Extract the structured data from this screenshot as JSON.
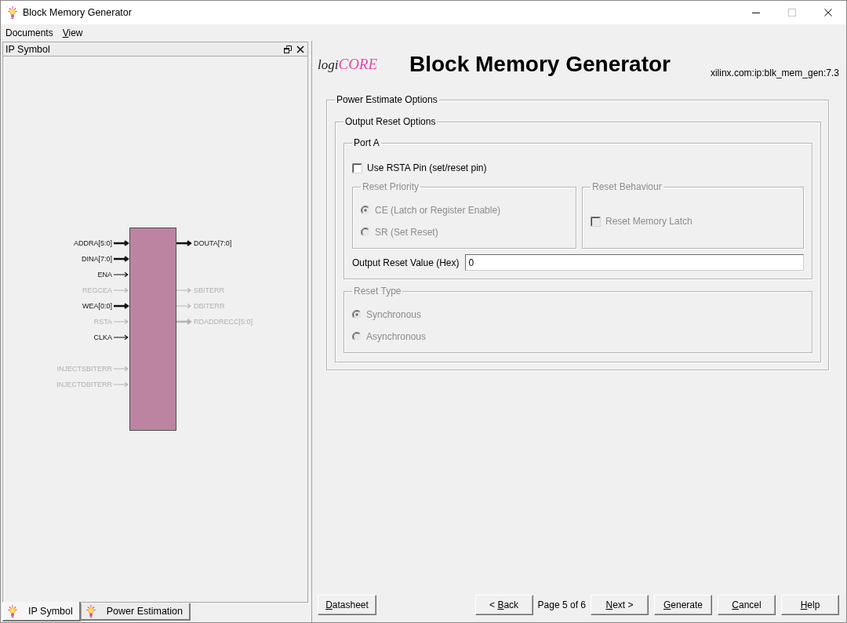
{
  "window": {
    "title": "Block Memory Generator",
    "controls": [
      {
        "kind": "minimize",
        "disabled": false
      },
      {
        "kind": "maximize",
        "disabled": true
      },
      {
        "kind": "close",
        "disabled": false
      }
    ]
  },
  "menu_bar": [
    {
      "parts": [
        {
          "text": "Documents",
          "underlined": false
        }
      ]
    },
    {
      "parts": [
        {
          "text": "V",
          "underlined": true
        },
        {
          "text": "iew",
          "underlined": false
        }
      ]
    }
  ],
  "left_panel": {
    "title": "IP Symbol",
    "header_buttons": [
      {
        "kind": "restore"
      },
      {
        "kind": "close"
      }
    ],
    "symbol": {
      "left_pin_groups": [
        {
          "pins": [
            {
              "name": "ADDRA[5:0]",
              "bus": true,
              "active": true
            },
            {
              "name": "DINA[7:0]",
              "bus": true,
              "active": true
            },
            {
              "name": "ENA",
              "bus": false,
              "active": true
            },
            {
              "name": "REGCEA",
              "bus": false,
              "active": false
            },
            {
              "name": "WEA[0:0]",
              "bus": true,
              "active": true
            },
            {
              "name": "RSTA",
              "bus": false,
              "active": false
            },
            {
              "name": "CLKA",
              "bus": false,
              "active": true
            }
          ]
        },
        {
          "pins": [
            {
              "name": "INJECTSBITERR",
              "bus": false,
              "active": false
            },
            {
              "name": "INJECTDBITERR",
              "bus": false,
              "active": false
            }
          ]
        }
      ],
      "right_pin_groups": [
        {
          "pins": [
            {
              "name": "DOUTA[7:0]",
              "bus": true,
              "active": true
            }
          ]
        },
        {
          "pins": [
            {
              "name": "SBITERR",
              "bus": false,
              "active": false
            },
            {
              "name": "DBITERR",
              "bus": false,
              "active": false
            },
            {
              "name": "RDADDRECC[5:0]",
              "bus": true,
              "active": false
            }
          ]
        }
      ]
    },
    "tabs": [
      {
        "label": "IP Symbol",
        "selected": true
      },
      {
        "label": "Power Estimation",
        "selected": false
      }
    ]
  },
  "header": {
    "logo": {
      "dark": "logi",
      "accent": "CORE"
    },
    "title": "Block Memory Generator",
    "ip_name": "xilinx.com:ip:blk_mem_gen:7.3"
  },
  "options": {
    "legend": "Power Estimate Options",
    "output_reset": {
      "legend": "Output Reset Options",
      "port_a": {
        "legend": "Port A",
        "use_rst_pin": {
          "label": "Use RSTA Pin (set/reset pin)",
          "checked": false,
          "disabled": false
        },
        "reset_priority": {
          "legend": "Reset Priority",
          "disabled": true,
          "options": [
            {
              "label": "CE (Latch or Register Enable)",
              "selected": true
            },
            {
              "label": "SR (Set Reset)",
              "selected": false
            }
          ]
        },
        "reset_behaviour": {
          "legend": "Reset Behaviour",
          "disabled": true,
          "reset_memory_latch": {
            "label": "Reset Memory Latch",
            "checked": false
          }
        },
        "output_reset_value": {
          "label": "Output Reset Value (Hex)",
          "value": "0"
        }
      },
      "reset_type": {
        "legend": "Reset Type",
        "disabled": true,
        "options": [
          {
            "label": "Synchronous",
            "selected": true
          },
          {
            "label": "Asynchronous",
            "selected": false
          }
        ]
      }
    }
  },
  "footer": {
    "datasheet_button": {
      "parts": [
        {
          "text": "D",
          "underlined": true
        },
        {
          "text": "atasheet",
          "underlined": false
        }
      ]
    },
    "navigation": [
      {
        "kind": "button",
        "parts": [
          {
            "text": "< ",
            "underlined": false
          },
          {
            "text": "B",
            "underlined": true
          },
          {
            "text": "ack",
            "underlined": false
          }
        ]
      },
      {
        "kind": "text",
        "text": "Page 5 of 6"
      },
      {
        "kind": "button",
        "parts": [
          {
            "text": "N",
            "underlined": true
          },
          {
            "text": "ext >",
            "underlined": false
          }
        ]
      },
      {
        "kind": "button",
        "parts": [
          {
            "text": "G",
            "underlined": true
          },
          {
            "text": "enerate",
            "underlined": false
          }
        ]
      },
      {
        "kind": "button",
        "parts": [
          {
            "text": "C",
            "underlined": true
          },
          {
            "text": "ancel",
            "underlined": false
          }
        ]
      },
      {
        "kind": "button",
        "parts": [
          {
            "text": "H",
            "underlined": true
          },
          {
            "text": "elp",
            "underlined": false
          }
        ]
      }
    ]
  }
}
